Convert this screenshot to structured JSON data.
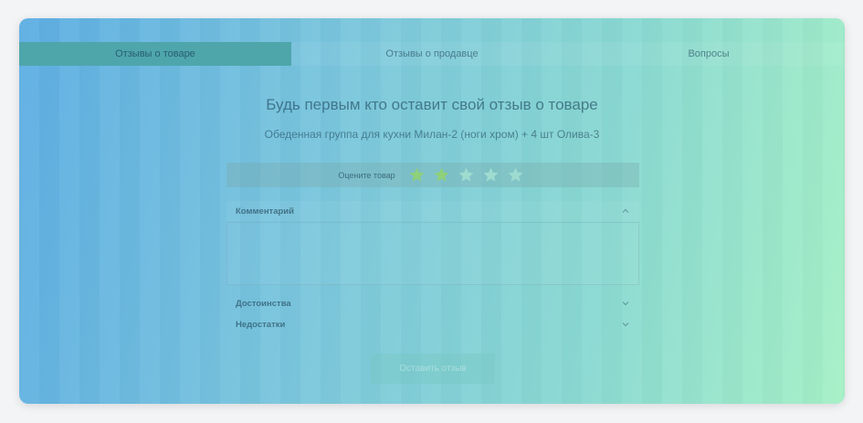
{
  "tabs": [
    {
      "label": "Отзывы о товаре",
      "active": true
    },
    {
      "label": "Отзывы о продавце",
      "active": false
    },
    {
      "label": "Вопросы",
      "active": false
    }
  ],
  "main": {
    "heading": "Будь первым кто оставит свой отзыв о товаре",
    "product_name": "Обеденная группа для кухни Милан-2 (ноги хром) + 4 шт Олива-3"
  },
  "rating": {
    "label": "Оцените товар",
    "value": 2,
    "max": 5,
    "filled_color": "#8fd07a",
    "empty_color": "#9fdcd0"
  },
  "form": {
    "comment_label": "Комментарий",
    "comment_value": "",
    "advantages_label": "Достоинства",
    "disadvantages_label": "Недостатки",
    "submit_label": "Оставить отзыв"
  },
  "colors": {
    "active_tab": "#4ea6ab",
    "gradient_start": "#5eaee3",
    "gradient_end": "#a5f0c6"
  }
}
